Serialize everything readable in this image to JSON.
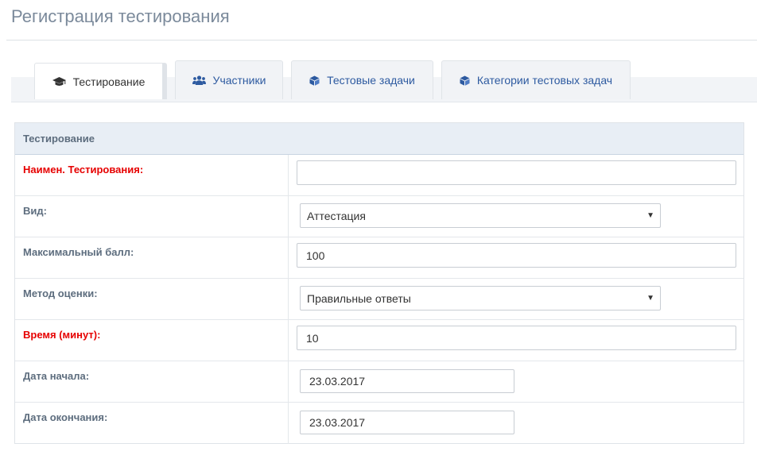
{
  "page": {
    "title": "Регистрация тестирования"
  },
  "tabs": [
    {
      "label": "Тестирование",
      "icon": "graduation-cap-icon",
      "active": true
    },
    {
      "label": "Участники",
      "icon": "users-icon",
      "active": false
    },
    {
      "label": "Тестовые задачи",
      "icon": "cube-icon",
      "active": false
    },
    {
      "label": "Категории тестовых задач",
      "icon": "cube-icon",
      "active": false
    }
  ],
  "form": {
    "header": "Тестирование",
    "fields": {
      "name": {
        "label": "Наимен. Тестирования:",
        "value": "",
        "required": true
      },
      "type": {
        "label": "Вид:",
        "value": "Аттестация"
      },
      "max_score": {
        "label": "Максимальный балл:",
        "value": "100"
      },
      "method": {
        "label": "Метод оценки:",
        "value": "Правильные ответы"
      },
      "time": {
        "label": "Время (минут):",
        "value": "10",
        "required": true
      },
      "start_date": {
        "label": "Дата начала:",
        "value": "23.03.2017"
      },
      "end_date": {
        "label": "Дата окончания:",
        "value": "23.03.2017"
      }
    }
  },
  "colors": {
    "accent": "#2d5aa0",
    "required": "#e60000",
    "muted": "#5d6d7e"
  }
}
